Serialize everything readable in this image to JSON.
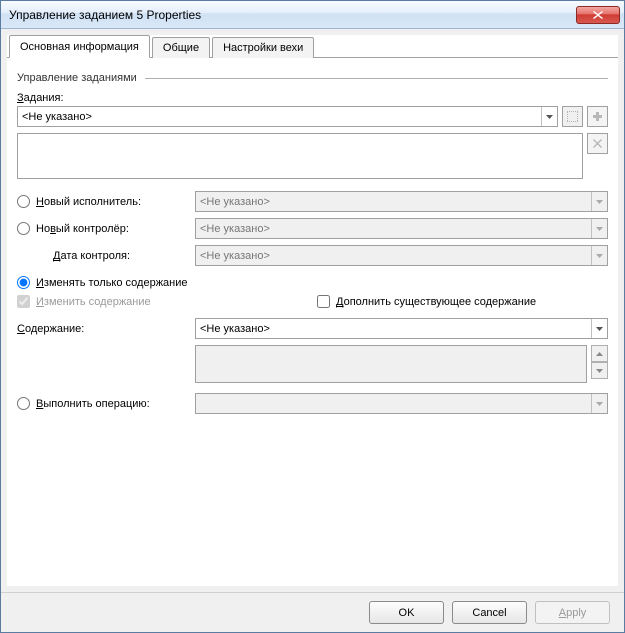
{
  "window": {
    "title": "Управление заданием 5 Properties"
  },
  "tabs": [
    {
      "label": "Основная информация"
    },
    {
      "label": "Общие"
    },
    {
      "label": "Настройки вехи"
    }
  ],
  "group": {
    "title": "Управление заданиями"
  },
  "tasks": {
    "label_pre": "З",
    "label_rest": "адания:",
    "value": "<Не указано>"
  },
  "list": {
    "value": ""
  },
  "radios": {
    "new_performer": {
      "pre": "Н",
      "rest": "овый исполнитель:",
      "value": "<Не указано>"
    },
    "new_controller": {
      "pre": "Но",
      "rest_u": "в",
      "rest2": "ый контролёр:",
      "value": "<Не указано>"
    },
    "control_date": {
      "pre": "Д",
      "rest": "ата контроля:",
      "value": "<Не указано>"
    },
    "content_only": {
      "pre": "И",
      "rest": "зменять только содержание"
    },
    "execute_op": {
      "pre": "В",
      "rest": "ыполнить операцию:",
      "value": ""
    }
  },
  "checks": {
    "change_content": {
      "pre": "И",
      "rest": "зменить содержание"
    },
    "append_content": {
      "pre": "Д",
      "rest": "ополнить существующее содержание"
    }
  },
  "content": {
    "label_pre": "С",
    "label_rest": "одержание:",
    "value": "<Не указано>"
  },
  "buttons": {
    "ok": "OK",
    "cancel": "Cancel",
    "apply_pre": "A",
    "apply_rest": "pply"
  }
}
